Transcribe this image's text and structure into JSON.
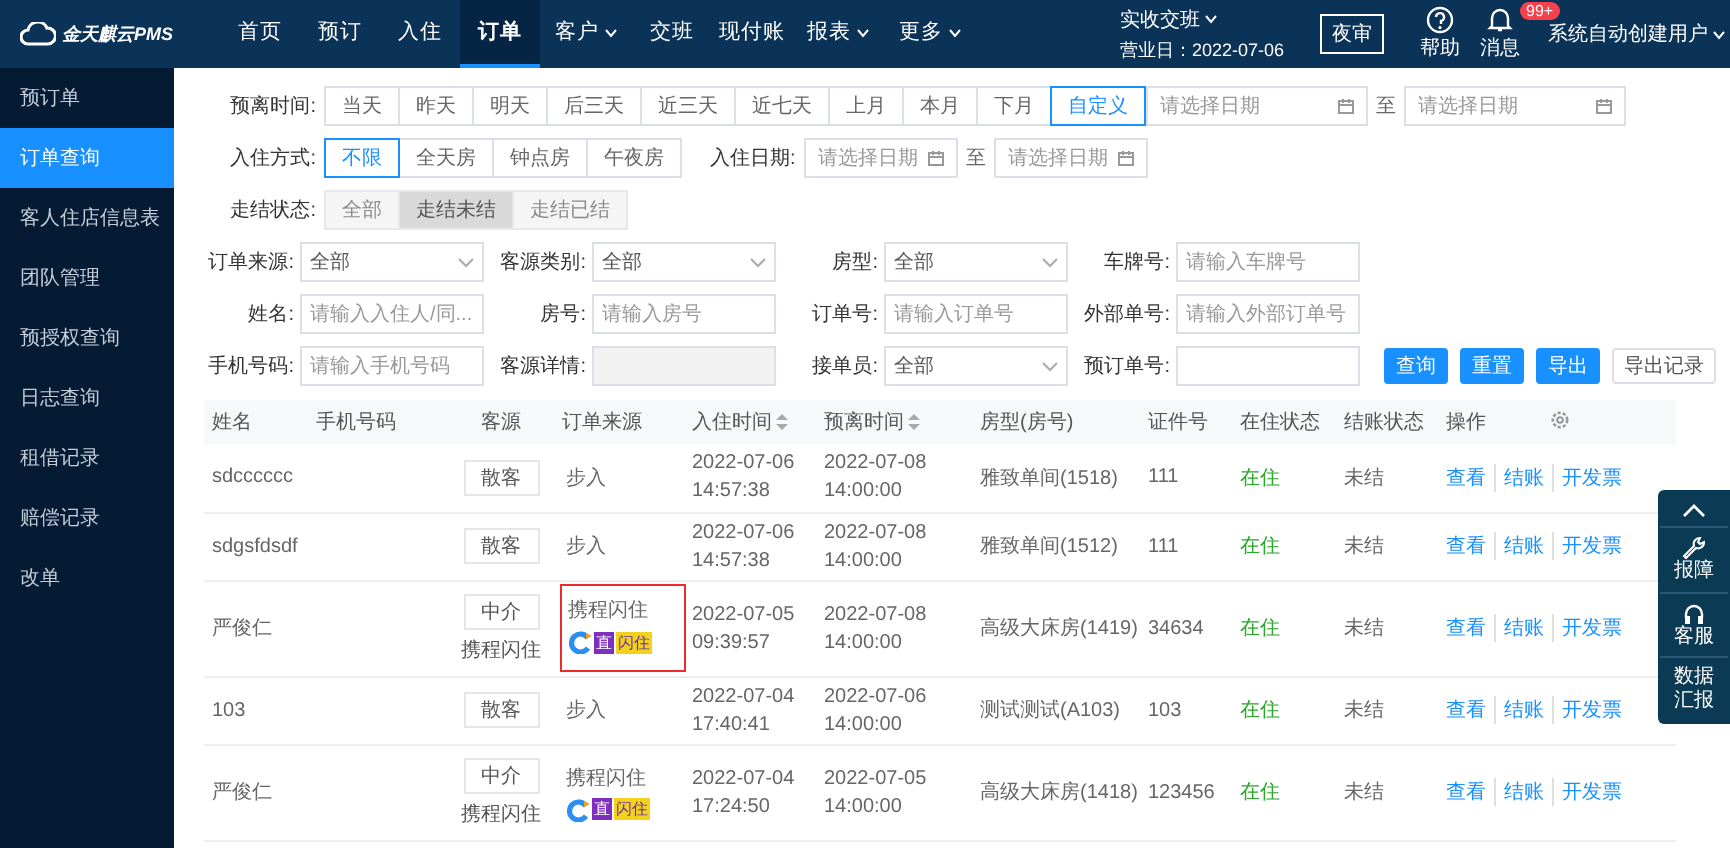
{
  "brand": "金天麒云PMS",
  "nav": [
    {
      "label": "首页",
      "selected": false,
      "dropdown": false
    },
    {
      "label": "预订",
      "selected": false,
      "dropdown": false
    },
    {
      "label": "入住",
      "selected": false,
      "dropdown": false
    },
    {
      "label": "订单",
      "selected": true,
      "dropdown": false
    },
    {
      "label": "客户",
      "selected": false,
      "dropdown": true
    },
    {
      "label": "交班",
      "selected": false,
      "dropdown": false
    },
    {
      "label": "现付账",
      "selected": false,
      "dropdown": false
    },
    {
      "label": "报表",
      "selected": false,
      "dropdown": true
    },
    {
      "label": "更多",
      "selected": false,
      "dropdown": true
    }
  ],
  "header": {
    "shift": "实收交班",
    "business_day": "营业日：2022-07-06",
    "night_audit": "夜审",
    "help": "帮助",
    "messages": "消息",
    "message_count": "99+",
    "user": "系统自动创建用户"
  },
  "sidebar": {
    "items": [
      {
        "label": "预订单",
        "selected": false
      },
      {
        "label": "订单查询",
        "selected": true
      },
      {
        "label": "客人住店信息表",
        "selected": false
      },
      {
        "label": "团队管理",
        "selected": false
      },
      {
        "label": "预授权查询",
        "selected": false
      },
      {
        "label": "日志查询",
        "selected": false
      },
      {
        "label": "租借记录",
        "selected": false
      },
      {
        "label": "赔偿记录",
        "selected": false
      },
      {
        "label": "改单",
        "selected": false
      }
    ]
  },
  "filters": {
    "departure": {
      "label": "预离时间:",
      "options": [
        {
          "label": "当天",
          "selected": false
        },
        {
          "label": "昨天",
          "selected": false
        },
        {
          "label": "明天",
          "selected": false
        },
        {
          "label": "后三天",
          "selected": false
        },
        {
          "label": "近三天",
          "selected": false
        },
        {
          "label": "近七天",
          "selected": false
        },
        {
          "label": "上月",
          "selected": false
        },
        {
          "label": "本月",
          "selected": false
        },
        {
          "label": "下月",
          "selected": false
        },
        {
          "label": "自定义",
          "selected": true
        }
      ],
      "from": "请选择日期",
      "to_label": "至",
      "to": "请选择日期"
    },
    "checkin_mode": {
      "label": "入住方式:",
      "options": [
        {
          "label": "不限",
          "selected": true
        },
        {
          "label": "全天房",
          "selected": false
        },
        {
          "label": "钟点房",
          "selected": false
        },
        {
          "label": "午夜房",
          "selected": false
        }
      ],
      "date_label": "入住日期:",
      "from": "请选择日期",
      "to_label": "至",
      "to": "请选择日期"
    },
    "checkout_status": {
      "label": "走结状态:",
      "disabled": true,
      "options": [
        {
          "label": "全部",
          "selected": false
        },
        {
          "label": "走结未结",
          "selected": true
        },
        {
          "label": "走结已结",
          "selected": false
        }
      ]
    },
    "fields": [
      {
        "label": "订单来源:",
        "kind": "select",
        "value": "全部"
      },
      {
        "label": "客源类别:",
        "kind": "select",
        "value": "全部"
      },
      {
        "label": "房型:",
        "kind": "select",
        "value": "全部"
      },
      {
        "label": "车牌号:",
        "kind": "input",
        "placeholder": "请输入车牌号"
      },
      {
        "label": "姓名:",
        "kind": "input",
        "placeholder": "请输入入住人/同..."
      },
      {
        "label": "房号:",
        "kind": "input",
        "placeholder": "请输入房号"
      },
      {
        "label": "订单号:",
        "kind": "input",
        "placeholder": "请输入订单号"
      },
      {
        "label": "外部单号:",
        "kind": "input",
        "placeholder": "请输入外部订单号"
      },
      {
        "label": "手机号码:",
        "kind": "input",
        "placeholder": "请输入手机号码"
      },
      {
        "label": "客源详情:",
        "kind": "disabled"
      },
      {
        "label": "接单员:",
        "kind": "select",
        "value": "全部"
      },
      {
        "label": "预订单号:",
        "kind": "input"
      }
    ],
    "buttons": [
      {
        "label": "查询",
        "kind": "primary"
      },
      {
        "label": "重置",
        "kind": "primary"
      },
      {
        "label": "导出",
        "kind": "primary"
      },
      {
        "label": "导出记录",
        "kind": "default"
      }
    ]
  },
  "table": {
    "columns": [
      {
        "label": "姓名",
        "sortable": false
      },
      {
        "label": "手机号码",
        "sortable": false
      },
      {
        "label": "客源",
        "sortable": false
      },
      {
        "label": "订单来源",
        "sortable": false
      },
      {
        "label": "入住时间",
        "sortable": true
      },
      {
        "label": "预离时间",
        "sortable": true
      },
      {
        "label": "房型(房号)",
        "sortable": false
      },
      {
        "label": "证件号",
        "sortable": false
      },
      {
        "label": "在住状态",
        "sortable": false
      },
      {
        "label": "结账状态",
        "sortable": false
      },
      {
        "label": "操作",
        "sortable": false
      }
    ],
    "rows": [
      {
        "name": "sdcccccc",
        "source_tag": "散客",
        "order_source": "步入",
        "highlighted": false,
        "checkin": [
          "2022-07-06",
          "14:57:38"
        ],
        "checkout": [
          "2022-07-08",
          "14:00:00"
        ],
        "room": "雅致单间(1518)",
        "id_no": "111",
        "stay_status": "在住",
        "bill_status": "未结",
        "actions": [
          "查看",
          "结账",
          "开发票"
        ]
      },
      {
        "name": "sdgsfdsdf",
        "source_tag": "散客",
        "order_source": "步入",
        "highlighted": false,
        "checkin": [
          "2022-07-06",
          "14:57:38"
        ],
        "checkout": [
          "2022-07-08",
          "14:00:00"
        ],
        "room": "雅致单间(1512)",
        "id_no": "111",
        "stay_status": "在住",
        "bill_status": "未结",
        "actions": [
          "查看",
          "结账",
          "开发票"
        ]
      },
      {
        "name": "严俊仁",
        "source_tag": "中介",
        "source_detail": "携程闪住",
        "order_source": "携程闪住",
        "badges": [
          "直",
          "闪住"
        ],
        "highlighted": true,
        "checkin": [
          "2022-07-05",
          "09:39:57"
        ],
        "checkout": [
          "2022-07-08",
          "14:00:00"
        ],
        "room": "高级大床房(1419)",
        "id_no": "34634",
        "stay_status": "在住",
        "bill_status": "未结",
        "actions": [
          "查看",
          "结账",
          "开发票"
        ]
      },
      {
        "name": "103",
        "source_tag": "散客",
        "order_source": "步入",
        "highlighted": false,
        "checkin": [
          "2022-07-04",
          "17:40:41"
        ],
        "checkout": [
          "2022-07-06",
          "14:00:00"
        ],
        "room": "测试测试(A103)",
        "id_no": "103",
        "stay_status": "在住",
        "bill_status": "未结",
        "actions": [
          "查看",
          "结账",
          "开发票"
        ]
      },
      {
        "name": "严俊仁",
        "source_tag": "中介",
        "source_detail": "携程闪住",
        "order_source": "携程闪住",
        "badges": [
          "直",
          "闪住"
        ],
        "highlighted": false,
        "checkin": [
          "2022-07-04",
          "17:24:50"
        ],
        "checkout": [
          "2022-07-05",
          "14:00:00"
        ],
        "room": "高级大床房(1418)",
        "id_no": "123456",
        "stay_status": "在住",
        "bill_status": "未结",
        "actions": [
          "查看",
          "结账",
          "开发票"
        ]
      }
    ]
  },
  "float_panel": [
    {
      "label": "报障",
      "kind": "wrench"
    },
    {
      "label": "客服",
      "kind": "headset"
    },
    {
      "label": "数据汇报",
      "kind": "report"
    }
  ]
}
